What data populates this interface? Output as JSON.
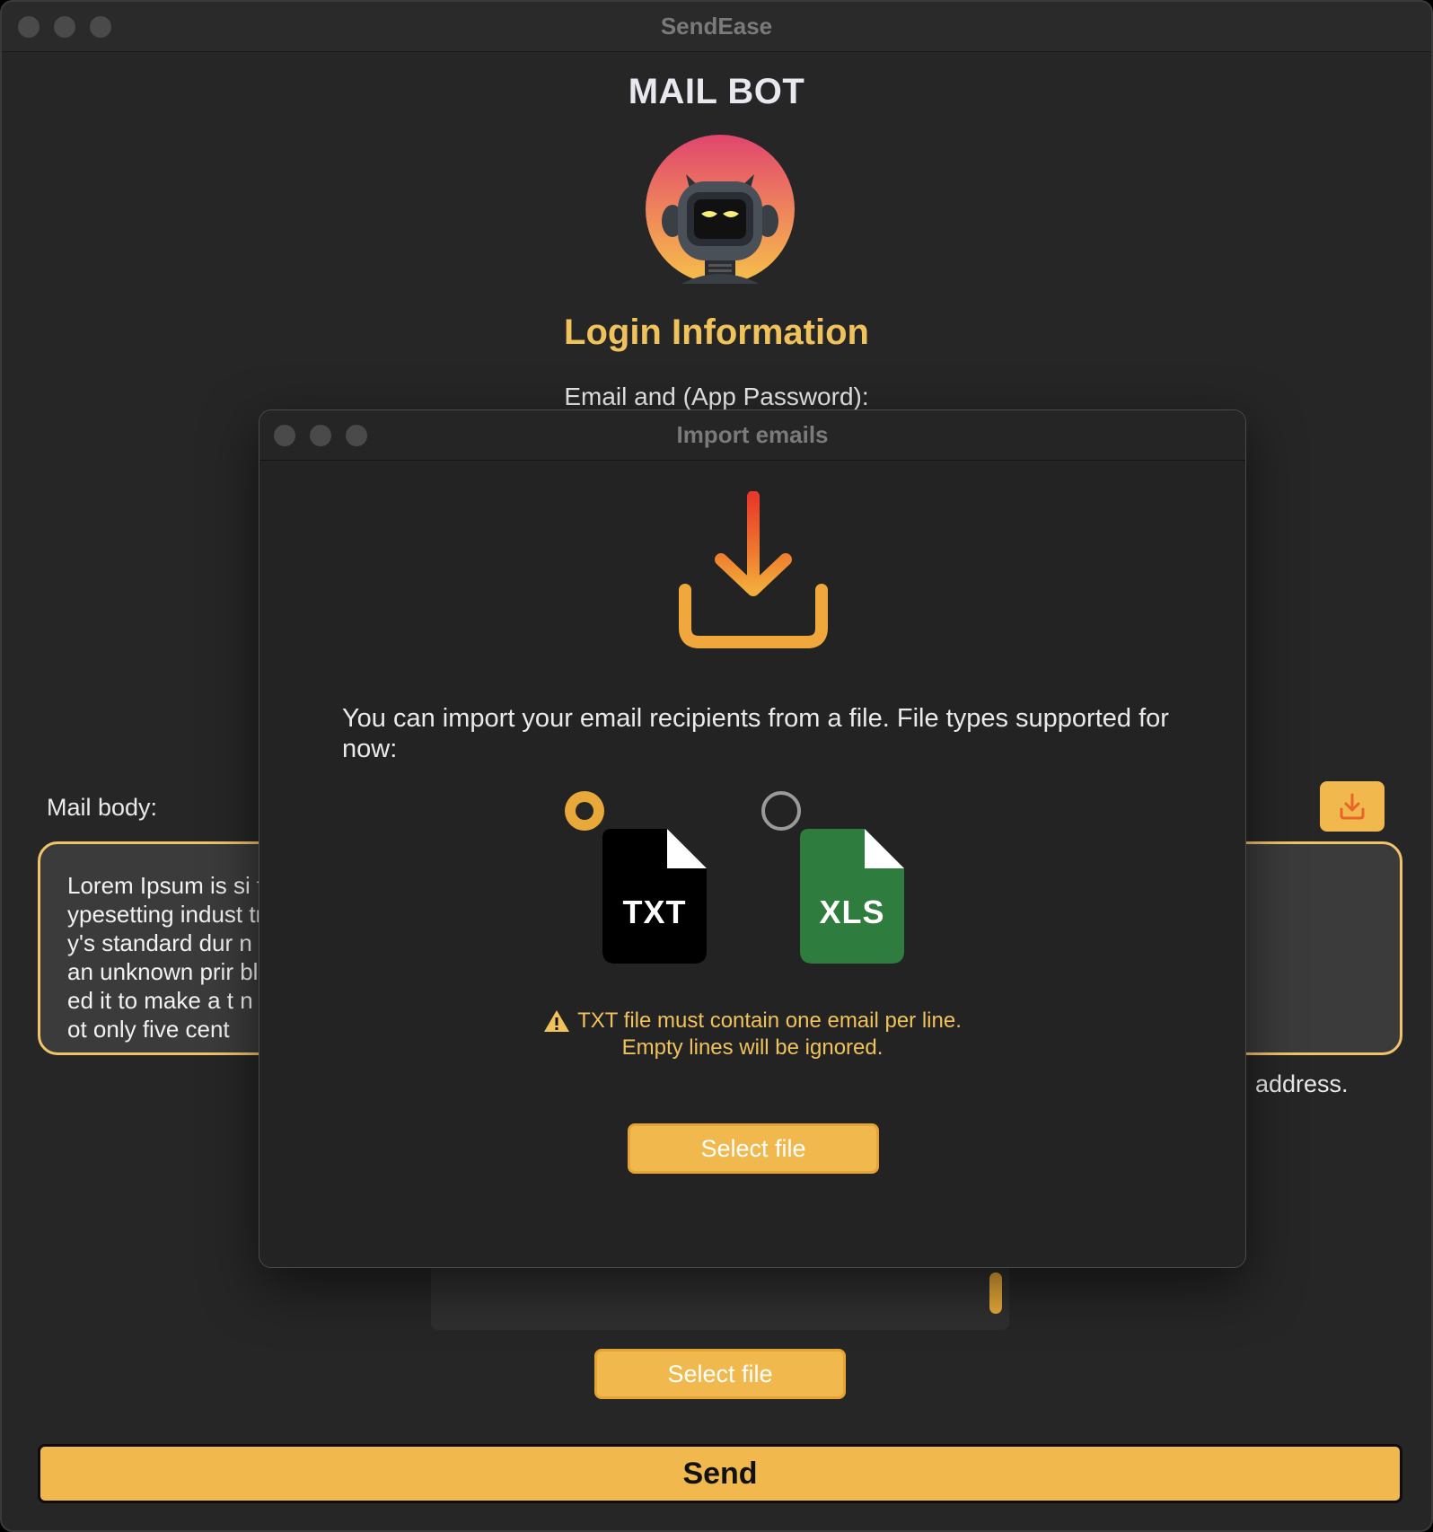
{
  "window": {
    "title": "SendEase"
  },
  "app": {
    "title": "MAIL BOT",
    "avatar_icon": "robot-avatar-icon",
    "login_heading": "Login Information",
    "email_label": "Email and (App Password):"
  },
  "mail_body": {
    "label": "Mail body:",
    "text": "Lorem Ipsum is si typesetting indust try's standard dur n an unknown prir bled it to make a t not only five cent",
    "import_icon": "download-tray-icon"
  },
  "partial_text": {
    "address": "address."
  },
  "main_actions": {
    "select_file_label": "Select file",
    "send_label": "Send"
  },
  "modal": {
    "title": "Import emails",
    "icon": "download-tray-icon",
    "description": "You can import your email recipients from a file. File types supported for now:",
    "options": [
      {
        "label": "TXT",
        "selected": true,
        "color": "#000000"
      },
      {
        "label": "XLS",
        "selected": false,
        "color": "#2e7d3e"
      }
    ],
    "warning_line1": "TXT file must contain one email per line.",
    "warning_line2": "Empty lines will be ignored.",
    "select_file_label": "Select file"
  },
  "colors": {
    "accent": "#f1b94d",
    "accent_text": "#f0c25c",
    "background": "#262626",
    "modal_background": "#232323"
  }
}
